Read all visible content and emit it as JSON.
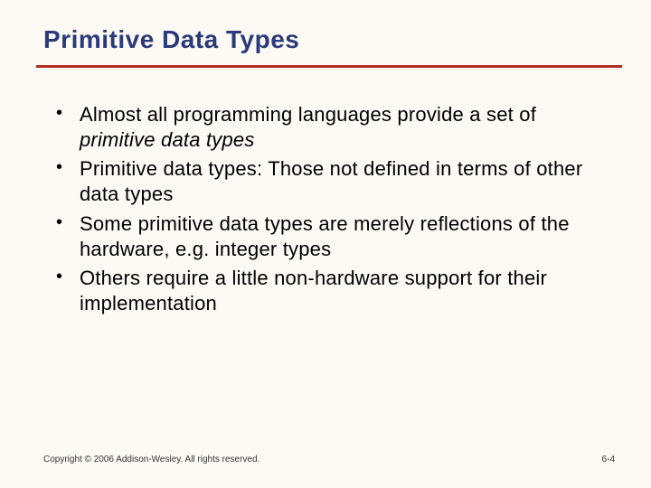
{
  "title": "Primitive Data Types",
  "bullets": [
    {
      "plain1": "Almost all programming languages provide a set of ",
      "italic": "primitive data types",
      "plain2": ""
    },
    {
      "plain1": "Primitive data types: Those not defined in terms of other data types",
      "italic": "",
      "plain2": ""
    },
    {
      "plain1": "Some primitive data types are merely reflections of the hardware, e.g. integer types",
      "italic": "",
      "plain2": ""
    },
    {
      "plain1": "Others require a little non-hardware support for their implementation",
      "italic": "",
      "plain2": ""
    }
  ],
  "footer": {
    "copyright": "Copyright © 2006 Addison-Wesley. All rights reserved.",
    "page": "6-4"
  }
}
